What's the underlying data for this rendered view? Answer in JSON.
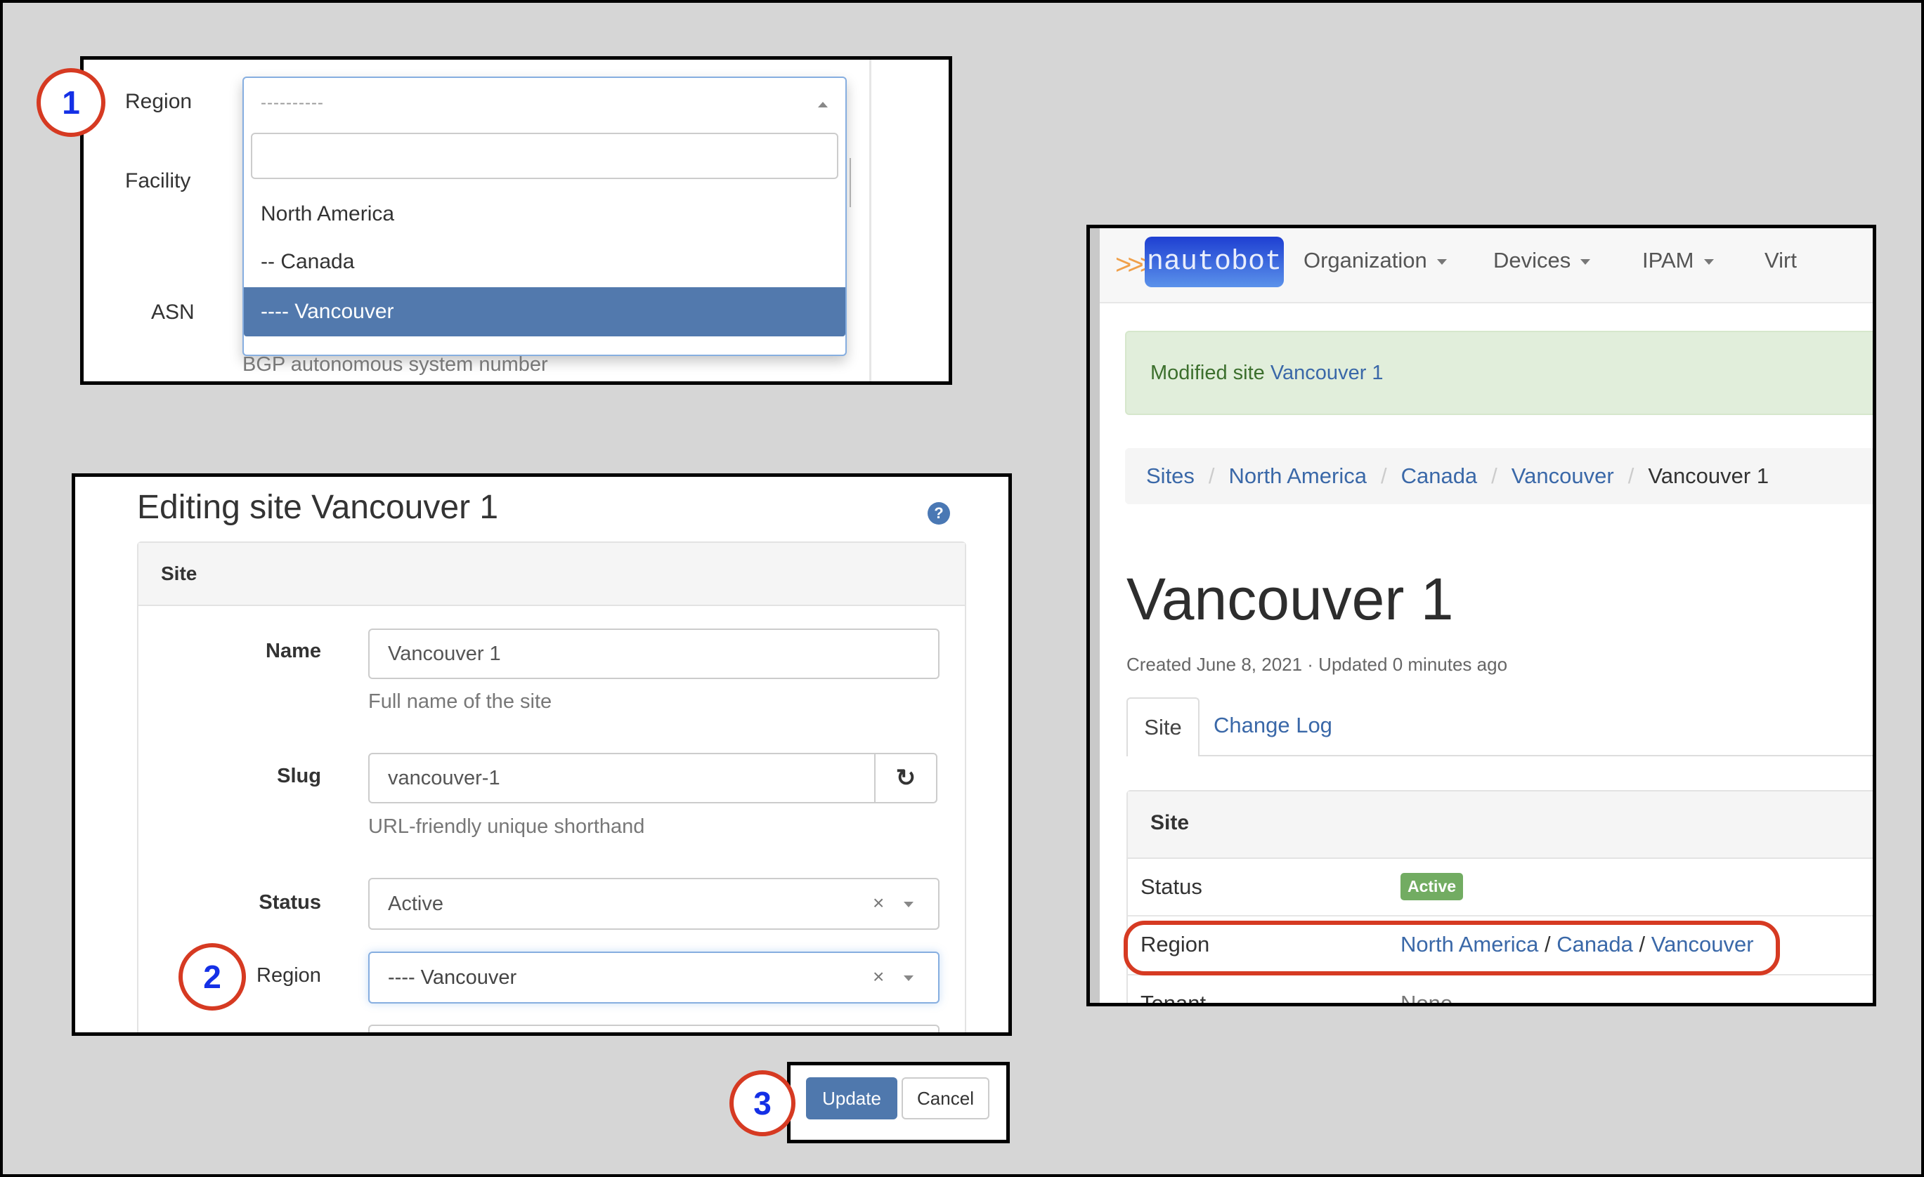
{
  "colors": {
    "annotation_ring": "#d63a22",
    "annotation_number": "#1430e6",
    "primary": "#4f78ad",
    "link": "#3a68a8",
    "success_bg": "#e1eedb",
    "success_text": "#3c6f2d",
    "badge_active": "#72ac62",
    "frame_bg": "#d6d6d6"
  },
  "steps": [
    "1",
    "2",
    "3"
  ],
  "dropdown_panel": {
    "labels": {
      "region": "Region",
      "facility": "Facility",
      "asn": "ASN"
    },
    "region_select_value": "----------",
    "search_value": "",
    "options": [
      {
        "label": "North America",
        "selected": false
      },
      {
        "label": "-- Canada",
        "selected": false
      },
      {
        "label": "---- Vancouver",
        "selected": true
      }
    ],
    "asn_help": "BGP autonomous system number"
  },
  "edit_panel": {
    "title": "Editing site Vancouver 1",
    "help_icon": "question-circle-icon",
    "section_title": "Site",
    "fields": {
      "name": {
        "label": "Name",
        "value": "Vancouver 1",
        "help": "Full name of the site"
      },
      "slug": {
        "label": "Slug",
        "value": "vancouver-1",
        "help": "URL-friendly unique shorthand",
        "regenerate_icon": "refresh-icon"
      },
      "status": {
        "label": "Status",
        "value": "Active",
        "clear": "×"
      },
      "region": {
        "label": "Region",
        "value": "---- Vancouver",
        "clear": "×"
      }
    }
  },
  "buttons": {
    "update": "Update",
    "cancel": "Cancel"
  },
  "site_view": {
    "nav": {
      "logo_arrows": ">>>",
      "logo_text": "nautobot",
      "items": [
        "Organization",
        "Devices",
        "IPAM",
        "Virt"
      ]
    },
    "alert": {
      "prefix": "Modified site ",
      "link": "Vancouver 1"
    },
    "breadcrumb": [
      {
        "label": "Sites",
        "link": true
      },
      {
        "label": "North America",
        "link": true
      },
      {
        "label": "Canada",
        "link": true
      },
      {
        "label": "Vancouver",
        "link": true
      },
      {
        "label": "Vancouver 1",
        "link": false
      }
    ],
    "breadcrumb_separator": "/",
    "title": "Vancouver 1",
    "meta": "Created June 8, 2021 · Updated 0 minutes ago",
    "tabs": [
      {
        "label": "Site",
        "active": true
      },
      {
        "label": "Change Log",
        "active": false
      }
    ],
    "table": {
      "header": "Site",
      "rows": [
        {
          "key": "Status",
          "badge": "Active"
        },
        {
          "key": "Region",
          "links": [
            "North America",
            "Canada",
            "Vancouver"
          ],
          "separator": " / "
        },
        {
          "key": "Tenant",
          "value": "None"
        }
      ]
    }
  }
}
